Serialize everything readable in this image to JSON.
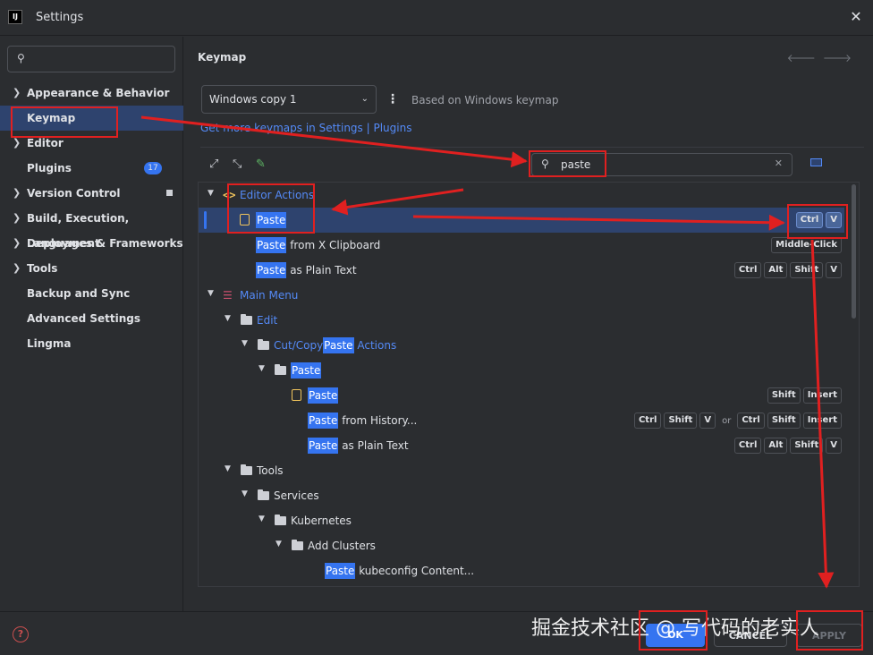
{
  "window": {
    "title": "Settings",
    "app_icon": "intellij-icon",
    "close_glyph": "✕"
  },
  "sidebar": {
    "search_placeholder": "",
    "items": [
      {
        "label": "Appearance & Behavior",
        "expandable": true
      },
      {
        "label": "Keymap",
        "selected": true
      },
      {
        "label": "Editor",
        "expandable": true
      },
      {
        "label": "Plugins",
        "badge": "17"
      },
      {
        "label": "Version Control",
        "expandable": true
      },
      {
        "label": "Build, Execution, Deployment",
        "expandable": true
      },
      {
        "label": "Languages & Frameworks",
        "expandable": true
      },
      {
        "label": "Tools",
        "expandable": true
      },
      {
        "label": "Backup and Sync"
      },
      {
        "label": "Advanced Settings"
      },
      {
        "label": "Lingma"
      }
    ]
  },
  "main": {
    "title": "Keymap",
    "keymap_select": "Windows copy 1",
    "based_on": "Based on Windows keymap",
    "get_more": "Get more keymaps in Settings | Plugins",
    "filter_value": "paste",
    "tree": {
      "editor_actions": "Editor Actions",
      "paste": "Paste",
      "from_x_clipboard": " from X Clipboard",
      "middle_click": "Middle-Click",
      "as_plain_text": " as Plain Text",
      "main_menu": "Main Menu",
      "edit": "Edit",
      "cut_copy": "Cut/Copy",
      "actions": " Actions",
      "from_history": " from History...",
      "or": "or",
      "tools": "Tools",
      "services": "Services",
      "kubernetes": "Kubernetes",
      "add_clusters": "Add Clusters",
      "kubeconfig_content": " kubeconfig Content..."
    },
    "keys": {
      "ctrl": "Ctrl",
      "v": "V",
      "alt": "Alt",
      "shift": "Shift",
      "insert": "Insert"
    }
  },
  "footer": {
    "ok": "OK",
    "cancel": "CANCEL",
    "apply": "APPLY",
    "help": "?"
  },
  "watermark": "掘金技术社区 @ 写代码的老实人",
  "colors": {
    "accent": "#3574f0",
    "annotation_red": "#e02020",
    "selection": "#2e436e"
  }
}
